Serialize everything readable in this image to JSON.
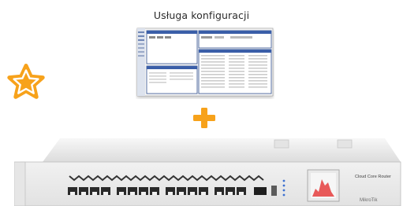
{
  "caption": "Usługa konfiguracji",
  "icons": {
    "star": "star-icon",
    "plus": "plus-icon"
  },
  "router": {
    "brand_label": "Cloud Core Router",
    "logo": "MikroTik"
  },
  "colors": {
    "accent": "#f7a21b",
    "router_body": "#ececec"
  }
}
